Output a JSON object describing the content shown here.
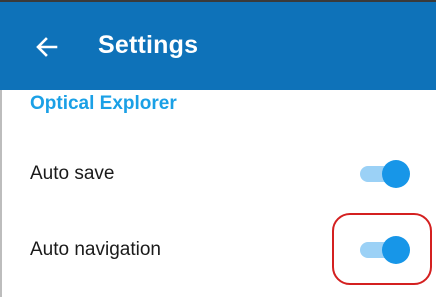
{
  "header": {
    "title": "Settings",
    "back_icon": "arrow-left-icon"
  },
  "section": {
    "title": "Optical Explorer"
  },
  "settings": [
    {
      "label": "Auto save",
      "enabled": true
    },
    {
      "label": "Auto navigation",
      "enabled": true
    }
  ],
  "colors": {
    "appbar": "#0e72b9",
    "accent": "#1aa0e6",
    "toggle_track": "#9bd1f6",
    "toggle_thumb": "#1796e8",
    "annotation": "#d42020"
  }
}
